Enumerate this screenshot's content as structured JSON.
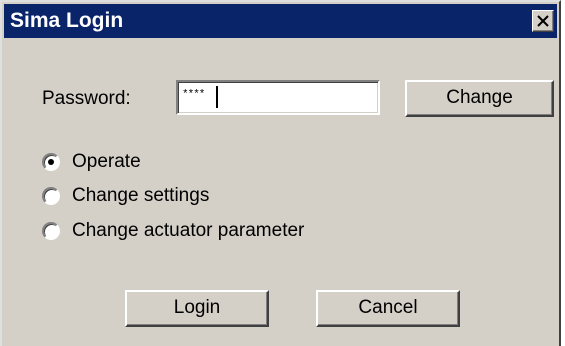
{
  "window": {
    "title": "Sima Login",
    "close_icon": "close-icon"
  },
  "password": {
    "label": "Password:",
    "value": "****"
  },
  "buttons": {
    "change": "Change",
    "login": "Login",
    "cancel": "Cancel"
  },
  "mode_options": [
    {
      "label": "Operate",
      "selected": true
    },
    {
      "label": "Change settings",
      "selected": false
    },
    {
      "label": "Change actuator parameter",
      "selected": false
    }
  ],
  "colors": {
    "titlebar": "#0a246a",
    "face": "#d4d0c8"
  }
}
